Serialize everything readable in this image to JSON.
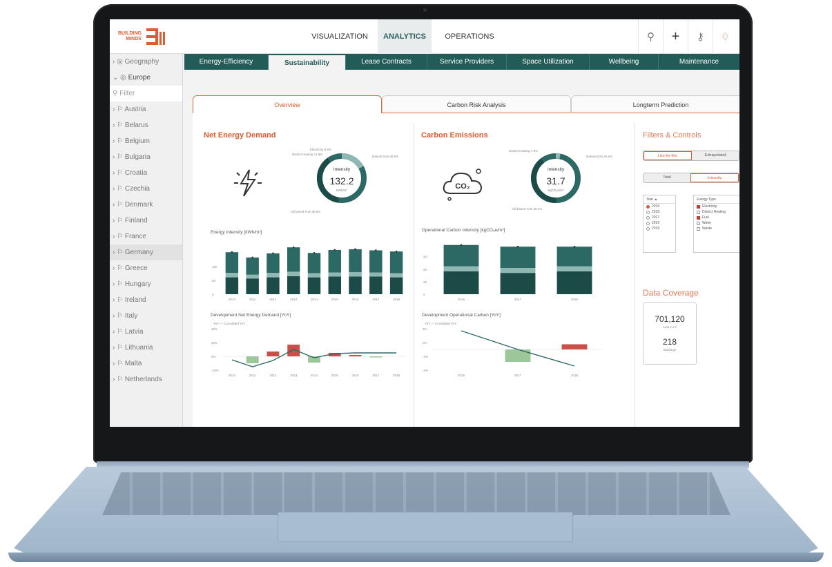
{
  "header": {
    "logo_line1": "BUILDING",
    "logo_line2": "MINDS",
    "nav": [
      "VISUALIZATION",
      "ANALYTICS",
      "OPERATIONS"
    ],
    "icons": [
      "search-icon",
      "plus-icon",
      "key-icon",
      "bell-icon"
    ]
  },
  "sidebar": {
    "geography": "Geography",
    "europe": "Europe",
    "filter_placeholder": "Filter",
    "countries": [
      "Austria",
      "Belarus",
      "Belgium",
      "Bulgaria",
      "Croatia",
      "Czechia",
      "Denmark",
      "Finland",
      "France",
      "Germany",
      "Greece",
      "Hungary",
      "Ireland",
      "Italy",
      "Latvia",
      "Lithuania",
      "Malta",
      "Netherlands"
    ],
    "highlighted": "Germany"
  },
  "tabs": [
    "Energy-Efficiency",
    "Sustainability",
    "Lease Contracts",
    "Service Providers",
    "Space Utilization",
    "Wellbeing",
    "Maintenance"
  ],
  "active_tab": "Sustainability",
  "subtabs": [
    "Overview",
    "Carbon Risk Analysis",
    "Longterm Prediction"
  ],
  "energy": {
    "title": "Net Energy Demand",
    "donut": {
      "label": "Intensity",
      "value": "132.2",
      "unit": "kWh/m²"
    },
    "donut_legend": [
      "Electricity 8.8%",
      "District Heating 11.8%",
      "Natural Gas 40.5%",
      "Oil-based Fuel 38.6%"
    ],
    "bar_title": "Energy Intensity [kWh/m²]",
    "dev_title": "Development Net Energy Demand [YoY]",
    "dev_legend": "YoY — Cumulated YoY"
  },
  "carbon": {
    "title": "Carbon Emissions",
    "donut": {
      "label": "Intensity",
      "value": "31.7",
      "unit": "kgCO₂e/m²"
    },
    "donut_legend": [
      "District Heating 7.5%",
      "Natural Gas 40.5%",
      "Oil-based Fuel 38.1%"
    ],
    "bar_title": "Operational Carbon Intensity [kgCO₂e/m²]",
    "dev_title": "Development Operational Carbon [YoY]",
    "dev_legend": "YoY — Cumulated YoY"
  },
  "filters": {
    "title": "Filters & Controls",
    "toggle1": [
      "Like-for-like",
      "Extrapolated"
    ],
    "toggle2": [
      "Total",
      "Intensity"
    ],
    "year_header": "Year",
    "years": [
      "2019",
      "2018",
      "2017",
      "2016",
      "2015"
    ],
    "energy_header": "Energy Type",
    "energy_types": [
      "Electricity",
      "District Heating",
      "Fuel",
      "Water",
      "Waste"
    ]
  },
  "coverage": {
    "title": "Data Coverage",
    "area": "701,120",
    "area_label": "Area in m²",
    "buildings": "218",
    "buildings_label": "Buildings"
  },
  "chart_data": [
    {
      "type": "bar",
      "title": "Energy Intensity [kWh/m²]",
      "categories": [
        "2010",
        "2011",
        "2012",
        "2013",
        "2014",
        "2015",
        "2016",
        "2017",
        "2018"
      ],
      "series": [
        {
          "values": [
            45,
            42,
            45,
            48,
            45,
            47,
            47,
            47,
            45
          ]
        },
        {
          "values": [
            12,
            10,
            12,
            12,
            11,
            11,
            12,
            11,
            11
          ]
        },
        {
          "values": [
            55,
            46,
            52,
            65,
            54,
            60,
            61,
            59,
            58
          ]
        }
      ],
      "ylim": [
        0,
        140
      ],
      "ytick_labels": [
        "0",
        "50",
        "100"
      ]
    },
    {
      "type": "bar",
      "title": "Operational Carbon Intensity [kgCO₂e/m²]",
      "categories": [
        "2016",
        "2017",
        "2018"
      ],
      "series": [
        {
          "values": [
            14,
            13,
            14
          ]
        },
        {
          "values": [
            3,
            3,
            3
          ]
        },
        {
          "values": [
            13,
            13,
            12
          ]
        }
      ],
      "ylim": [
        0,
        32
      ],
      "ytick_labels": [
        "0",
        "10",
        "20",
        "30"
      ]
    },
    {
      "type": "bar",
      "title": "Development Net Energy Demand [YoY]",
      "categories": [
        "2010",
        "2011",
        "2012",
        "2013",
        "2014",
        "2015",
        "2016",
        "2017",
        "2018"
      ],
      "values": [
        0,
        -10,
        7,
        17,
        -9,
        5,
        2,
        -1,
        0
      ],
      "line": [
        -5,
        -15,
        -6,
        10,
        -2,
        4,
        5,
        5,
        5
      ],
      "ylim": [
        -20,
        40
      ],
      "ytick_labels": [
        "-20%",
        "0%",
        "20%",
        "40%"
      ]
    },
    {
      "type": "bar",
      "title": "Development Operational Carbon [YoY]",
      "categories": [
        "2016",
        "2017",
        "2018"
      ],
      "values": [
        0,
        -12,
        5
      ],
      "line": [
        18,
        0,
        -16
      ],
      "ylim": [
        -20,
        20
      ],
      "ytick_labels": [
        "-4%",
        "-2%",
        "0%",
        "2%"
      ]
    }
  ]
}
